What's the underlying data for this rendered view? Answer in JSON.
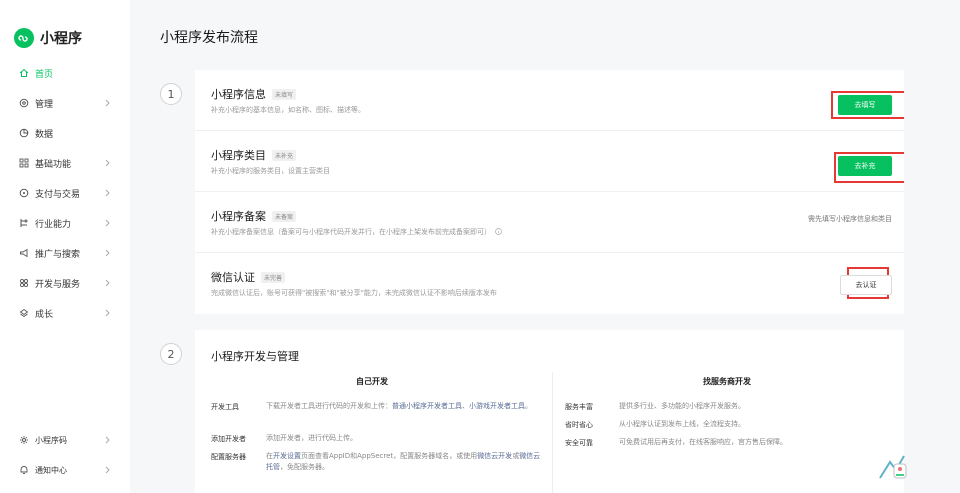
{
  "app": {
    "name": "小程序"
  },
  "sidebar": {
    "items": [
      {
        "label": "首页",
        "icon": "home-icon",
        "active": true,
        "arrow": false
      },
      {
        "label": "管理",
        "icon": "settings-icon",
        "active": false,
        "arrow": true
      },
      {
        "label": "数据",
        "icon": "pie-chart-icon",
        "active": false,
        "arrow": false
      },
      {
        "label": "基础功能",
        "icon": "grid-icon",
        "active": false,
        "arrow": true
      },
      {
        "label": "支付与交易",
        "icon": "payment-icon",
        "active": false,
        "arrow": true
      },
      {
        "label": "行业能力",
        "icon": "industry-icon",
        "active": false,
        "arrow": true
      },
      {
        "label": "推广与搜索",
        "icon": "promotion-icon",
        "active": false,
        "arrow": true
      },
      {
        "label": "开发与服务",
        "icon": "dev-icon",
        "active": false,
        "arrow": true
      },
      {
        "label": "成长",
        "icon": "growth-icon",
        "active": false,
        "arrow": true
      }
    ],
    "bottom_items": [
      {
        "label": "小程序码",
        "icon": "qrcode-icon",
        "arrow": true
      },
      {
        "label": "通知中心",
        "icon": "bell-icon",
        "arrow": true
      }
    ]
  },
  "page": {
    "title": "小程序发布流程"
  },
  "steps": [
    {
      "number": "1"
    },
    {
      "number": "2"
    }
  ],
  "step1": {
    "rows": [
      {
        "title": "小程序信息",
        "tag": "未填写",
        "desc": "补充小程序的基本信息，如名称、图标、描述等。",
        "button": "去填写"
      },
      {
        "title": "小程序类目",
        "tag": "未补充",
        "desc": "补充小程序的服务类目，设置主营类目",
        "button": "去补充"
      },
      {
        "title": "小程序备案",
        "tag": "未备案",
        "desc": "补充小程序备案信息（备案可与小程序代码开发并行，在小程序上架发布前完成备案即可）",
        "hint": "需先填写小程序信息和类目"
      },
      {
        "title": "微信认证",
        "tag": "未完善",
        "desc": "完成微信认证后，账号可获得\"被搜索\"和\"被分享\"能力，未完成微信认证不影响后续版本发布",
        "button": "去认证"
      }
    ]
  },
  "step2": {
    "title": "小程序开发与管理",
    "self_dev": {
      "heading": "自己开发",
      "items": [
        {
          "label": "开发工具",
          "text1": "下载开发者工具进行代码的开发和上传：",
          "link1": "普通小程序开发者工具",
          "text2": "、",
          "link2": "小游戏开发者工具",
          "text3": "。"
        },
        {
          "label": "添加开发者",
          "text": "添加开发者，进行代码上传。"
        },
        {
          "label": "配置服务器",
          "text1": "在",
          "link1": "开发设置",
          "text2": "页面查看AppID和AppSecret，配置服务器域名，或使用",
          "link2": "微信云开发",
          "text3": "或",
          "link3": "微信云托管",
          "text4": "，免配服务器。"
        }
      ]
    },
    "vendor_dev": {
      "heading": "找服务商开发",
      "items": [
        {
          "label": "服务丰富",
          "text": "提供多行业、多功能的小程序开发服务。"
        },
        {
          "label": "省时省心",
          "text": "从小程序认证到发布上线，全流程支持。"
        },
        {
          "label": "安全可靠",
          "text": "可免费试用后再支付，在线客服响应，官方售后保障。"
        }
      ]
    }
  },
  "colors": {
    "accent": "#07c160",
    "highlight": "#e53935",
    "link": "#576b95"
  }
}
